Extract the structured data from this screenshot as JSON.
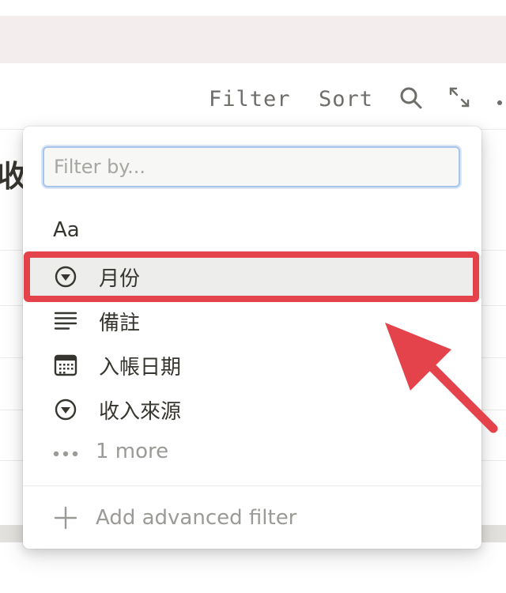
{
  "toolbar": {
    "filter_label": "Filter",
    "sort_label": "Sort",
    "search_icon": "search-icon",
    "expand_icon": "expand-icon",
    "more_icon": "more-icon"
  },
  "background": {
    "partial_title": "收"
  },
  "popup": {
    "search": {
      "placeholder": "Filter by...",
      "value": ""
    },
    "title_property": "Aa",
    "properties": [
      {
        "label": "月份",
        "icon": "select-icon",
        "highlighted": true
      },
      {
        "label": "備註",
        "icon": "text-lines-icon",
        "highlighted": false
      },
      {
        "label": "入帳日期",
        "icon": "calendar-icon",
        "highlighted": false
      },
      {
        "label": "收入來源",
        "icon": "select-icon",
        "highlighted": false
      }
    ],
    "more_label": "1 more",
    "add_filter_label": "Add advanced filter"
  },
  "annotation": {
    "highlight_color": "#e5434b",
    "arrow_color": "#e5434b"
  }
}
